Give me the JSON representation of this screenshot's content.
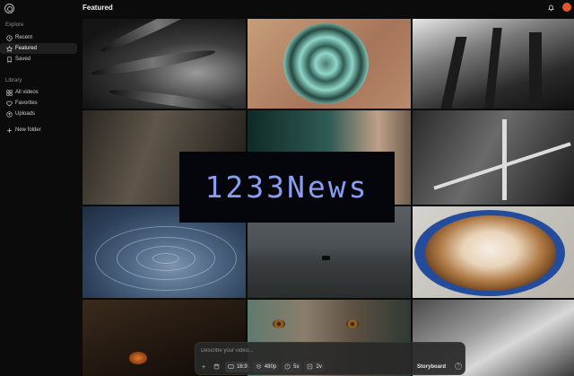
{
  "header": {
    "title": "Featured"
  },
  "sidebar": {
    "explore_label": "Explore",
    "explore_items": [
      {
        "label": "Recent",
        "icon": "clock-icon"
      },
      {
        "label": "Featured",
        "icon": "star-icon",
        "active": true
      },
      {
        "label": "Saved",
        "icon": "bookmark-icon"
      }
    ],
    "library_label": "Library",
    "library_items": [
      {
        "label": "All videos",
        "icon": "grid-icon"
      },
      {
        "label": "Favorites",
        "icon": "heart-icon"
      },
      {
        "label": "Uploads",
        "icon": "upload-icon"
      }
    ],
    "new_folder": {
      "label": "New folder",
      "icon": "plus-icon"
    }
  },
  "watermark": {
    "text": "1233News"
  },
  "prompt": {
    "placeholder": "Describe your video...",
    "aspect_ratio": "16:9",
    "resolution": "480p",
    "duration": "5s",
    "variations": "2v",
    "storyboard_label": "Storyboard"
  },
  "colors": {
    "accent": "#e0572a",
    "watermark": "#8a9ef0",
    "active_nav_bg": "#1f1f1f"
  }
}
